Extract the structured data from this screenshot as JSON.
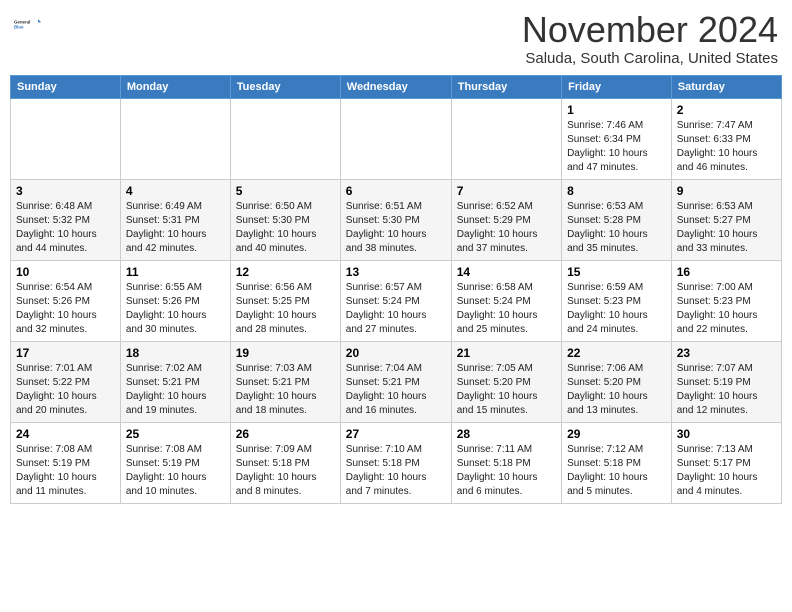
{
  "header": {
    "logo_line1": "General",
    "logo_line2": "Blue",
    "month": "November 2024",
    "location": "Saluda, South Carolina, United States"
  },
  "weekdays": [
    "Sunday",
    "Monday",
    "Tuesday",
    "Wednesday",
    "Thursday",
    "Friday",
    "Saturday"
  ],
  "weeks": [
    [
      {
        "day": "",
        "info": ""
      },
      {
        "day": "",
        "info": ""
      },
      {
        "day": "",
        "info": ""
      },
      {
        "day": "",
        "info": ""
      },
      {
        "day": "",
        "info": ""
      },
      {
        "day": "1",
        "info": "Sunrise: 7:46 AM\nSunset: 6:34 PM\nDaylight: 10 hours and 47 minutes."
      },
      {
        "day": "2",
        "info": "Sunrise: 7:47 AM\nSunset: 6:33 PM\nDaylight: 10 hours and 46 minutes."
      }
    ],
    [
      {
        "day": "3",
        "info": "Sunrise: 6:48 AM\nSunset: 5:32 PM\nDaylight: 10 hours and 44 minutes."
      },
      {
        "day": "4",
        "info": "Sunrise: 6:49 AM\nSunset: 5:31 PM\nDaylight: 10 hours and 42 minutes."
      },
      {
        "day": "5",
        "info": "Sunrise: 6:50 AM\nSunset: 5:30 PM\nDaylight: 10 hours and 40 minutes."
      },
      {
        "day": "6",
        "info": "Sunrise: 6:51 AM\nSunset: 5:30 PM\nDaylight: 10 hours and 38 minutes."
      },
      {
        "day": "7",
        "info": "Sunrise: 6:52 AM\nSunset: 5:29 PM\nDaylight: 10 hours and 37 minutes."
      },
      {
        "day": "8",
        "info": "Sunrise: 6:53 AM\nSunset: 5:28 PM\nDaylight: 10 hours and 35 minutes."
      },
      {
        "day": "9",
        "info": "Sunrise: 6:53 AM\nSunset: 5:27 PM\nDaylight: 10 hours and 33 minutes."
      }
    ],
    [
      {
        "day": "10",
        "info": "Sunrise: 6:54 AM\nSunset: 5:26 PM\nDaylight: 10 hours and 32 minutes."
      },
      {
        "day": "11",
        "info": "Sunrise: 6:55 AM\nSunset: 5:26 PM\nDaylight: 10 hours and 30 minutes."
      },
      {
        "day": "12",
        "info": "Sunrise: 6:56 AM\nSunset: 5:25 PM\nDaylight: 10 hours and 28 minutes."
      },
      {
        "day": "13",
        "info": "Sunrise: 6:57 AM\nSunset: 5:24 PM\nDaylight: 10 hours and 27 minutes."
      },
      {
        "day": "14",
        "info": "Sunrise: 6:58 AM\nSunset: 5:24 PM\nDaylight: 10 hours and 25 minutes."
      },
      {
        "day": "15",
        "info": "Sunrise: 6:59 AM\nSunset: 5:23 PM\nDaylight: 10 hours and 24 minutes."
      },
      {
        "day": "16",
        "info": "Sunrise: 7:00 AM\nSunset: 5:23 PM\nDaylight: 10 hours and 22 minutes."
      }
    ],
    [
      {
        "day": "17",
        "info": "Sunrise: 7:01 AM\nSunset: 5:22 PM\nDaylight: 10 hours and 20 minutes."
      },
      {
        "day": "18",
        "info": "Sunrise: 7:02 AM\nSunset: 5:21 PM\nDaylight: 10 hours and 19 minutes."
      },
      {
        "day": "19",
        "info": "Sunrise: 7:03 AM\nSunset: 5:21 PM\nDaylight: 10 hours and 18 minutes."
      },
      {
        "day": "20",
        "info": "Sunrise: 7:04 AM\nSunset: 5:21 PM\nDaylight: 10 hours and 16 minutes."
      },
      {
        "day": "21",
        "info": "Sunrise: 7:05 AM\nSunset: 5:20 PM\nDaylight: 10 hours and 15 minutes."
      },
      {
        "day": "22",
        "info": "Sunrise: 7:06 AM\nSunset: 5:20 PM\nDaylight: 10 hours and 13 minutes."
      },
      {
        "day": "23",
        "info": "Sunrise: 7:07 AM\nSunset: 5:19 PM\nDaylight: 10 hours and 12 minutes."
      }
    ],
    [
      {
        "day": "24",
        "info": "Sunrise: 7:08 AM\nSunset: 5:19 PM\nDaylight: 10 hours and 11 minutes."
      },
      {
        "day": "25",
        "info": "Sunrise: 7:08 AM\nSunset: 5:19 PM\nDaylight: 10 hours and 10 minutes."
      },
      {
        "day": "26",
        "info": "Sunrise: 7:09 AM\nSunset: 5:18 PM\nDaylight: 10 hours and 8 minutes."
      },
      {
        "day": "27",
        "info": "Sunrise: 7:10 AM\nSunset: 5:18 PM\nDaylight: 10 hours and 7 minutes."
      },
      {
        "day": "28",
        "info": "Sunrise: 7:11 AM\nSunset: 5:18 PM\nDaylight: 10 hours and 6 minutes."
      },
      {
        "day": "29",
        "info": "Sunrise: 7:12 AM\nSunset: 5:18 PM\nDaylight: 10 hours and 5 minutes."
      },
      {
        "day": "30",
        "info": "Sunrise: 7:13 AM\nSunset: 5:17 PM\nDaylight: 10 hours and 4 minutes."
      }
    ]
  ]
}
